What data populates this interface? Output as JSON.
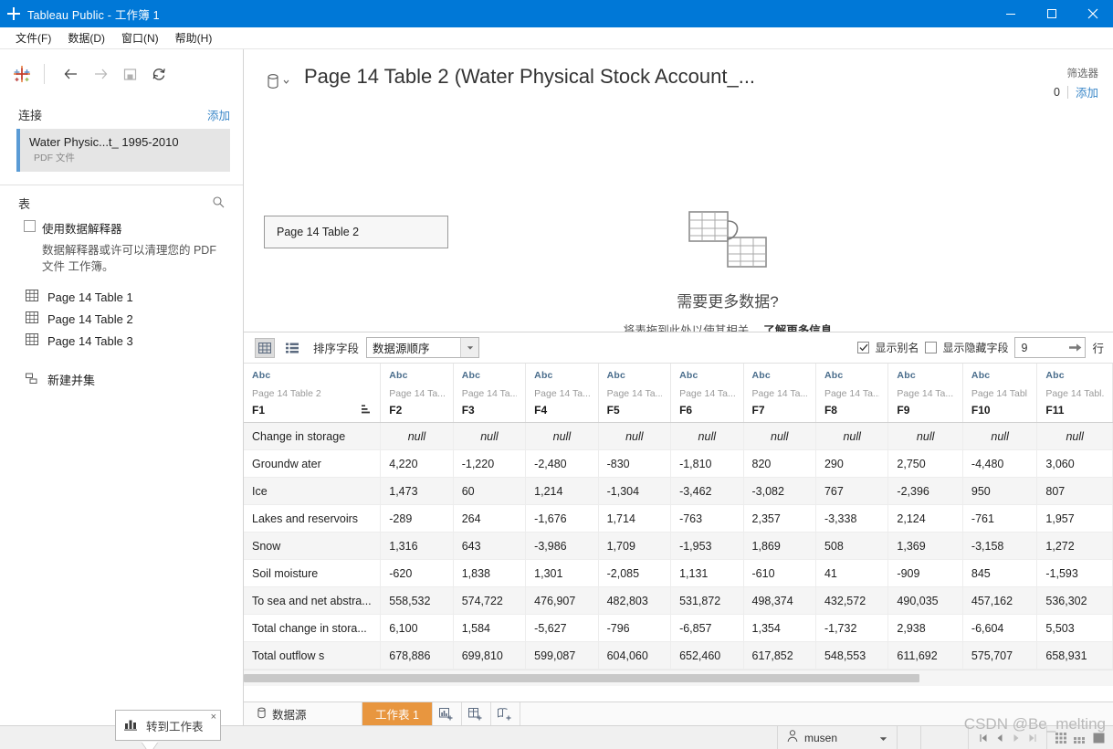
{
  "window": {
    "title": "Tableau Public - 工作簿 1",
    "minimize_label": "最小化",
    "maximize_label": "最大化",
    "close_label": "关闭"
  },
  "menu": {
    "items": [
      {
        "label": "文件(F)"
      },
      {
        "label": "数据(D)"
      },
      {
        "label": "窗口(N)"
      },
      {
        "label": "帮助(H)"
      }
    ]
  },
  "left_toolbar": {
    "back_label": "后退",
    "forward_label": "前进",
    "save_label": "保存",
    "refresh_label": "刷新"
  },
  "connections": {
    "title": "连接",
    "add_label": "添加",
    "items": [
      {
        "name": "Water Physic...t_ 1995-2010",
        "type": "PDF 文件"
      }
    ]
  },
  "tables_panel": {
    "title": "表",
    "search_label": "搜索",
    "interpreter_checkbox_label": "使用数据解释器",
    "interpreter_checked": false,
    "interpreter_note": "数据解释器或许可以清理您的 PDF 文件 工作簿。",
    "tables": [
      {
        "label": "Page  14 Table  1"
      },
      {
        "label": "Page  14 Table  2"
      },
      {
        "label": "Page  14 Table  3"
      }
    ],
    "new_union_label": "新建并集"
  },
  "datasource_header": {
    "title": "Page  14 Table  2 (Water Physical Stock Account_...",
    "filters_label": "筛选器",
    "filters_count": "0",
    "filters_add": "添加"
  },
  "canvas": {
    "table_card_label": "Page 14 Table 2",
    "need_more_title": "需要更多数据?",
    "need_more_sub": "将表拖到此处以使其相关。",
    "need_more_link": "了解更多信息"
  },
  "grid_toolbar": {
    "grid_view_label": "网格视图",
    "list_view_label": "列表视图",
    "sort_fields_label": "排序字段",
    "sort_value": "数据源顺序",
    "show_aliases_label": "显示别名",
    "show_aliases_checked": true,
    "show_hidden_label": "显示隐藏字段",
    "show_hidden_checked": false,
    "rows_value": "9",
    "rows_unit": "行"
  },
  "grid": {
    "columns": [
      {
        "type": "Abc",
        "source": "Page  14 Table  2",
        "field": "F1",
        "has_sort_icon": true
      },
      {
        "type": "Abc",
        "source": "Page  14 Ta...",
        "field": "F2",
        "has_sort_icon": false
      },
      {
        "type": "Abc",
        "source": "Page  14 Ta...",
        "field": "F3",
        "has_sort_icon": false
      },
      {
        "type": "Abc",
        "source": "Page  14 Ta...",
        "field": "F4",
        "has_sort_icon": false
      },
      {
        "type": "Abc",
        "source": "Page  14 Ta...",
        "field": "F5",
        "has_sort_icon": false
      },
      {
        "type": "Abc",
        "source": "Page  14 Ta...",
        "field": "F6",
        "has_sort_icon": false
      },
      {
        "type": "Abc",
        "source": "Page  14 Ta...",
        "field": "F7",
        "has_sort_icon": false
      },
      {
        "type": "Abc",
        "source": "Page  14 Ta...",
        "field": "F8",
        "has_sort_icon": false
      },
      {
        "type": "Abc",
        "source": "Page  14 Ta...",
        "field": "F9",
        "has_sort_icon": false
      },
      {
        "type": "Abc",
        "source": "Page  14 Tabl...",
        "field": "F10",
        "has_sort_icon": false
      },
      {
        "type": "Abc",
        "source": "Page  14 Tabl...",
        "field": "F11",
        "has_sort_icon": false
      }
    ],
    "null_text": "null",
    "rows": [
      [
        "Change in storage",
        "null",
        "null",
        "null",
        "null",
        "null",
        "null",
        "null",
        "null",
        "null",
        "null"
      ],
      [
        "Groundw ater",
        "4,220",
        "-1,220",
        "-2,480",
        "-830",
        "-1,810",
        "820",
        "290",
        "2,750",
        "-4,480",
        "3,060"
      ],
      [
        "Ice",
        "1,473",
        "60",
        "1,214",
        "-1,304",
        "-3,462",
        "-3,082",
        "767",
        "-2,396",
        "950",
        "807"
      ],
      [
        "Lakes and reservoirs",
        "-289",
        "264",
        "-1,676",
        "1,714",
        "-763",
        "2,357",
        "-3,338",
        "2,124",
        "-761",
        "1,957"
      ],
      [
        "Snow",
        "1,316",
        "643",
        "-3,986",
        "1,709",
        "-1,953",
        "1,869",
        "508",
        "1,369",
        "-3,158",
        "1,272"
      ],
      [
        "Soil moisture",
        "-620",
        "1,838",
        "1,301",
        "-2,085",
        "1,131",
        "-610",
        "41",
        "-909",
        "845",
        "-1,593"
      ],
      [
        "To sea and net abstra...",
        "558,532",
        "574,722",
        "476,907",
        "482,803",
        "531,872",
        "498,374",
        "432,572",
        "490,035",
        "457,162",
        "536,302"
      ],
      [
        "Total change in stora...",
        "6,100",
        "1,584",
        "-5,627",
        "-796",
        "-6,857",
        "1,354",
        "-1,732",
        "2,938",
        "-6,604",
        "5,503"
      ],
      [
        "Total outflow s",
        "678,886",
        "699,810",
        "599,087",
        "604,060",
        "652,460",
        "617,852",
        "548,553",
        "611,692",
        "575,707",
        "658,931"
      ]
    ]
  },
  "tooltip": {
    "text": "转到工作表",
    "close_label": "×"
  },
  "bottom_tabs": {
    "datasource_label": "数据源",
    "sheets": [
      {
        "label": "工作表 1",
        "active": true
      }
    ],
    "new_sheet_label": "新建工作表",
    "new_dashboard_label": "新建仪表板",
    "new_story_label": "新建故事"
  },
  "statusbar": {
    "user": "musen",
    "watermark": "CSDN @Be_melting"
  },
  "colors": {
    "titlebar_blue": "#0078d7",
    "link_blue": "#3a87c8",
    "active_tab_orange": "#e8963f",
    "conn_accent": "#5a9bd5"
  }
}
